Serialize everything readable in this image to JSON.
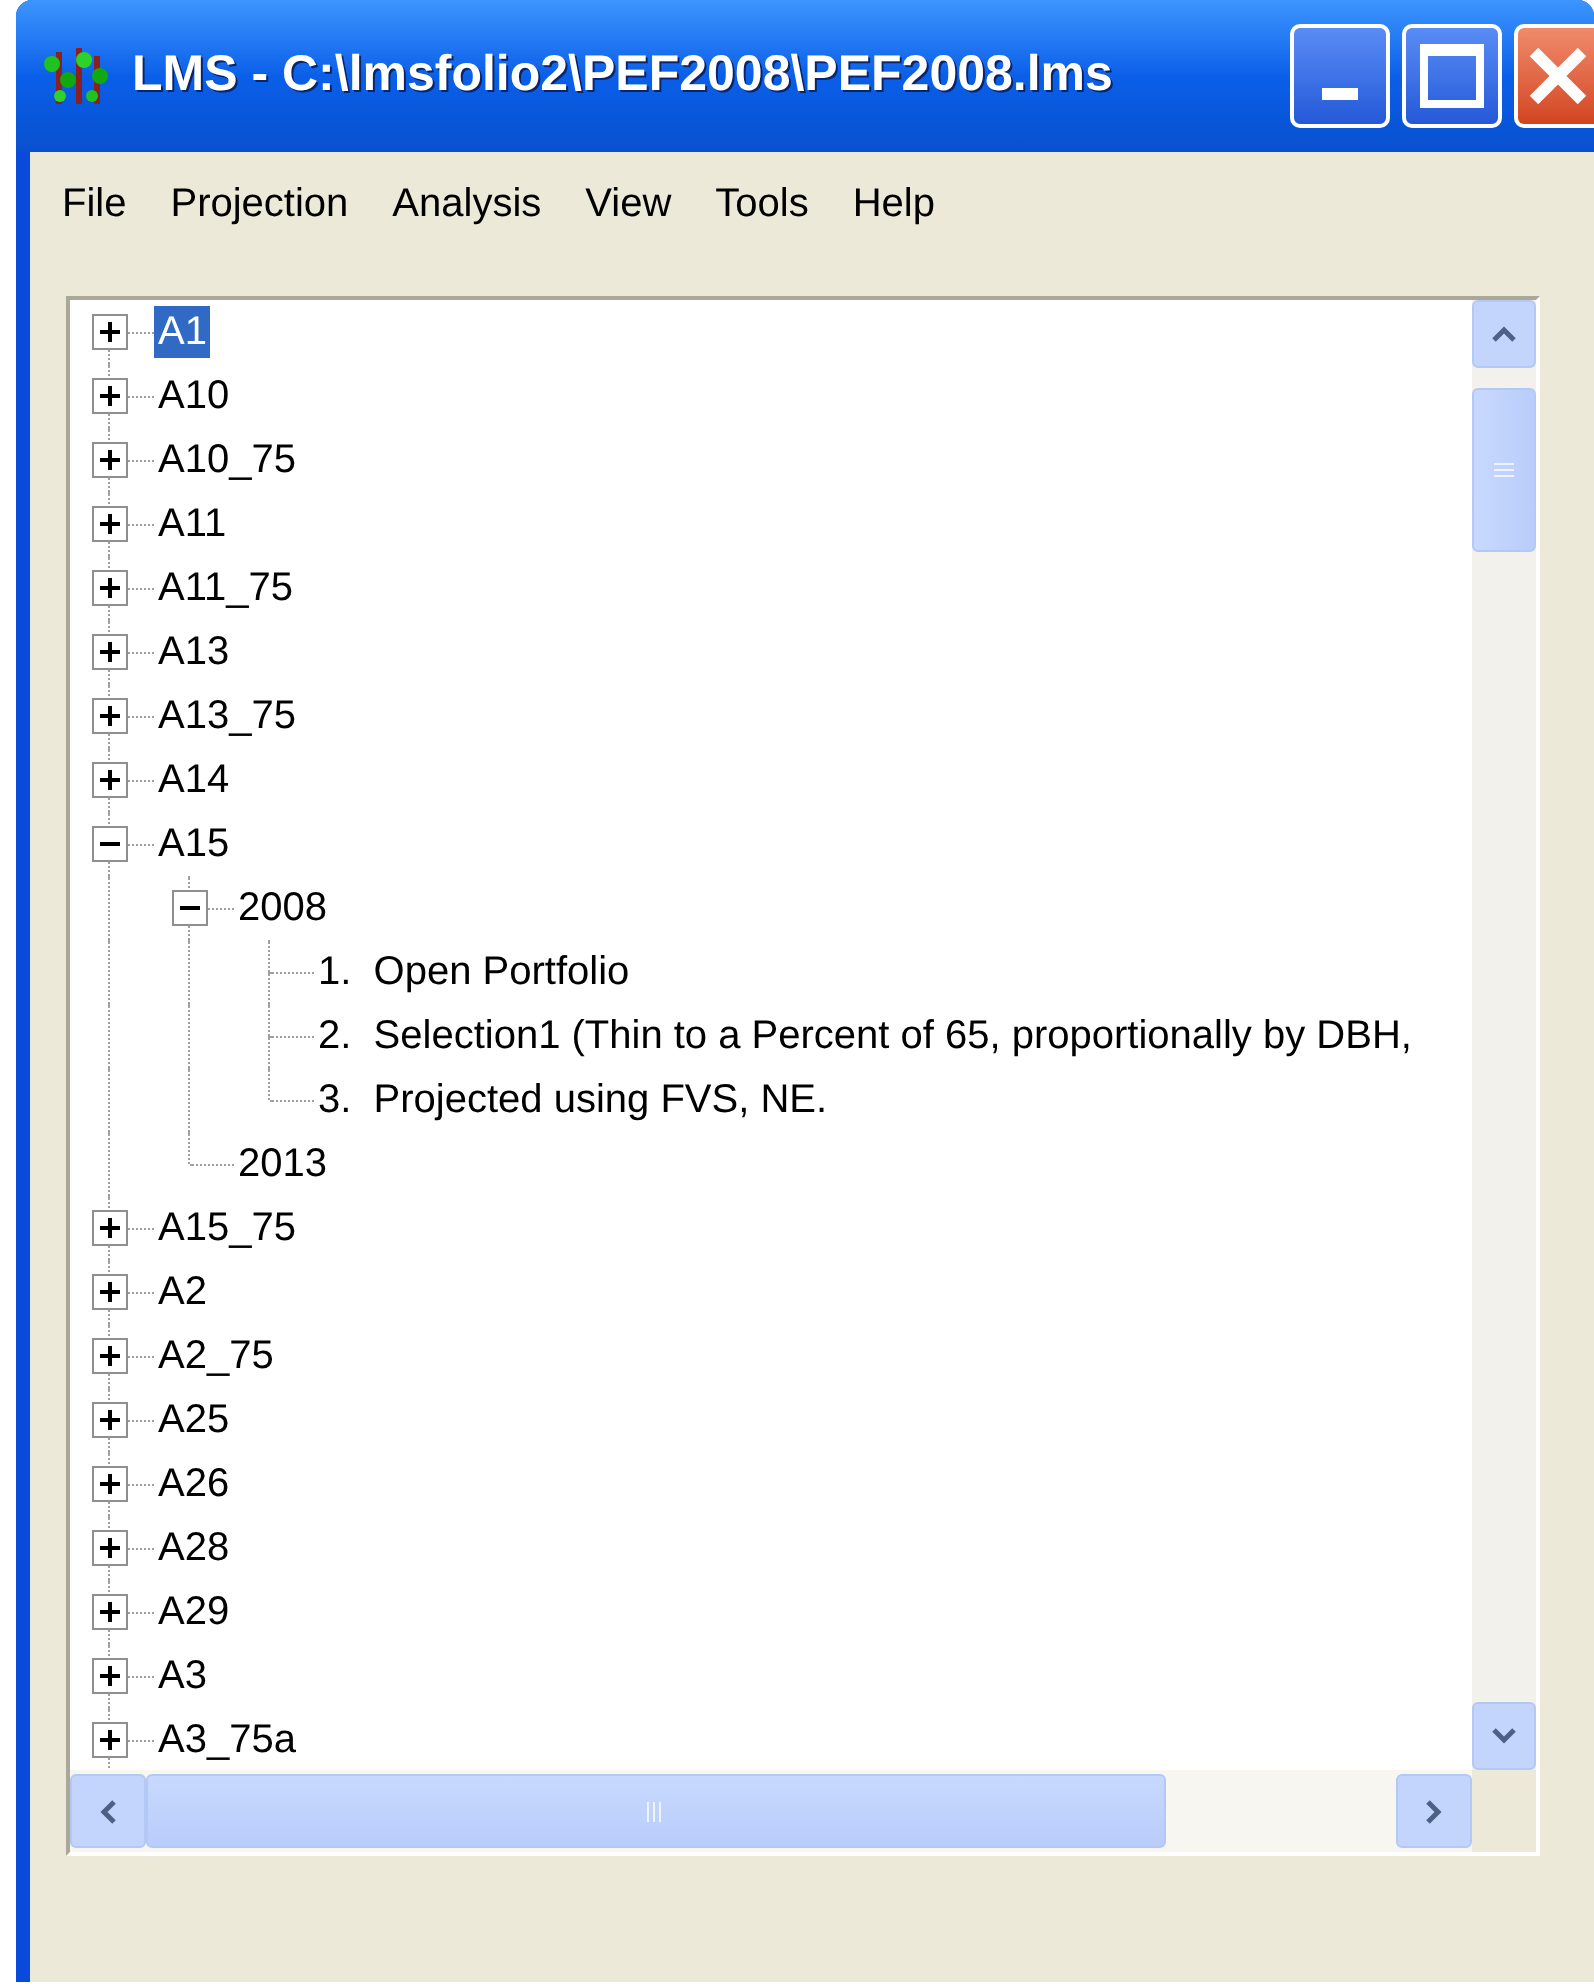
{
  "window": {
    "title": "LMS - C:\\lmsfolio2\\PEF2008\\PEF2008.lms"
  },
  "menu": [
    "File",
    "Projection",
    "Analysis",
    "View",
    "Tools",
    "Help"
  ],
  "tree": [
    {
      "label": "A1",
      "selected": true,
      "expanded": false
    },
    {
      "label": "A10",
      "selected": false,
      "expanded": false
    },
    {
      "label": "A10_75",
      "selected": false,
      "expanded": false
    },
    {
      "label": "A11",
      "selected": false,
      "expanded": false
    },
    {
      "label": "A11_75",
      "selected": false,
      "expanded": false
    },
    {
      "label": "A13",
      "selected": false,
      "expanded": false
    },
    {
      "label": "A13_75",
      "selected": false,
      "expanded": false
    },
    {
      "label": "A14",
      "selected": false,
      "expanded": false
    },
    {
      "label": "A15",
      "selected": false,
      "expanded": true,
      "children": [
        {
          "label": "2008",
          "selected": false,
          "expanded": true,
          "children": [
            {
              "label": "1.  Open Portfolio",
              "selected": false
            },
            {
              "label": "2.  Selection1 (Thin to a Percent of 65, proportionally by DBH,",
              "selected": false
            },
            {
              "label": "3.  Projected using FVS, NE.",
              "selected": false
            }
          ]
        },
        {
          "label": "2013",
          "selected": false
        }
      ]
    },
    {
      "label": "A15_75",
      "selected": false,
      "expanded": false
    },
    {
      "label": "A2",
      "selected": false,
      "expanded": false
    },
    {
      "label": "A2_75",
      "selected": false,
      "expanded": false
    },
    {
      "label": "A25",
      "selected": false,
      "expanded": false
    },
    {
      "label": "A26",
      "selected": false,
      "expanded": false
    },
    {
      "label": "A28",
      "selected": false,
      "expanded": false
    },
    {
      "label": "A29",
      "selected": false,
      "expanded": false
    },
    {
      "label": "A3",
      "selected": false,
      "expanded": false
    },
    {
      "label": "A3_75a",
      "selected": false,
      "expanded": false
    }
  ]
}
